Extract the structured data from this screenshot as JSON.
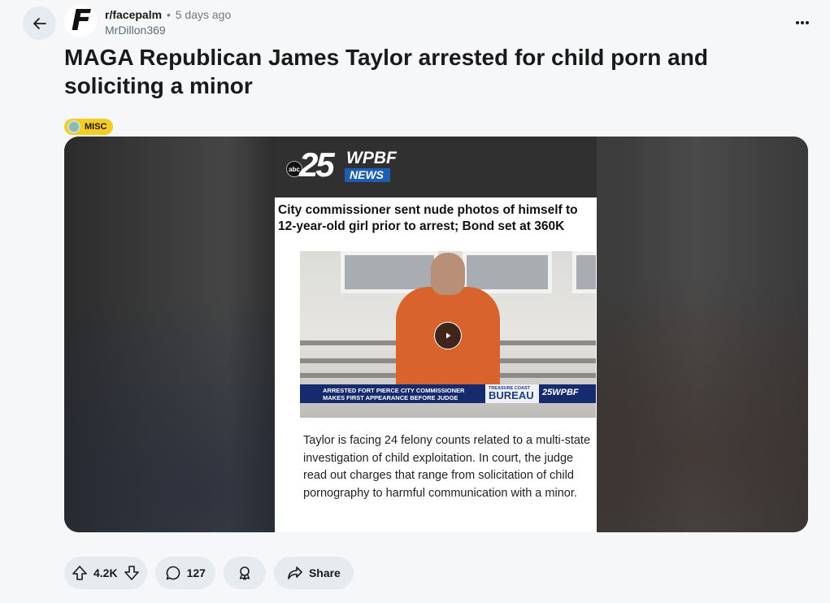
{
  "post": {
    "subreddit": "r/facepalm",
    "separator": "•",
    "time_ago": "5 days ago",
    "author": "MrDillon369",
    "avatar_glyph": "F",
    "title": "MAGA Republican James Taylor arrested for child porn and soliciting a minor",
    "flair": {
      "label": "MISC",
      "color": "#f5cc22"
    }
  },
  "media": {
    "brand": {
      "badge": "abc",
      "number": "25",
      "name": "WPBF",
      "news": "NEWS"
    },
    "headline": "City commissioner sent nude photos of himself to 12-year-old girl prior to arrest; Bond set at 360K",
    "video": {
      "lower_third_line1": "ARRESTED FORT PIERCE CITY COMMISSIONER",
      "lower_third_line2": "MAKES FIRST APPEARANCE BEFORE JUDGE",
      "bureau_small": "TREASURE COAST",
      "bureau_big": "BUREAU",
      "station": "25WPBF"
    },
    "body": "Taylor is facing 24 felony counts related to a multi-state investigation of child exploitation. In court, the judge read out charges that range from solicitation of child pornography to harmful communication with a minor."
  },
  "actions": {
    "score": "4.2K",
    "comments": "127",
    "share_label": "Share"
  },
  "icons": [
    "back-arrow-icon",
    "more-options-icon",
    "upvote-icon",
    "downvote-icon",
    "comment-icon",
    "award-icon",
    "share-icon",
    "play-icon"
  ]
}
